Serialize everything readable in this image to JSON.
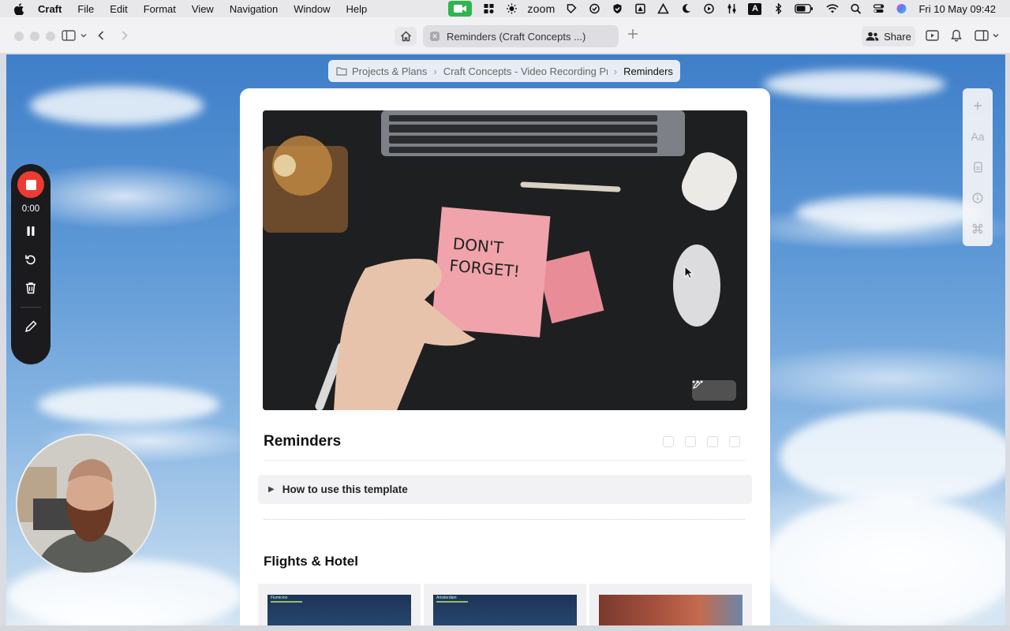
{
  "menubar": {
    "app_name": "Craft",
    "items": [
      "File",
      "Edit",
      "Format",
      "View",
      "Navigation",
      "Window",
      "Help"
    ],
    "status_zoom": "zoom",
    "status_a": "A",
    "clock": "Fri 10 May  09:42"
  },
  "window": {
    "tab_title": "Reminders (Craft Concepts ...)",
    "share_label": "Share"
  },
  "breadcrumb": {
    "items": [
      "Projects & Plans",
      "Craft Concepts - Video Recording Pr",
      "Reminders"
    ]
  },
  "document": {
    "hero_note_line1": "DON'T",
    "hero_note_line2": "FORGET!",
    "title": "Reminders",
    "toggle_label": "How to use this template",
    "section_title": "Flights & Hotel",
    "card_labels": [
      "Fiumicino",
      "Amsterdam"
    ]
  },
  "recorder": {
    "time": "0:00"
  },
  "right_tools": {
    "text_style": "Aa"
  },
  "colors": {
    "accent_record": "#ec3b33",
    "facetime_green": "#2fb550",
    "sky": "#5d98d6"
  }
}
